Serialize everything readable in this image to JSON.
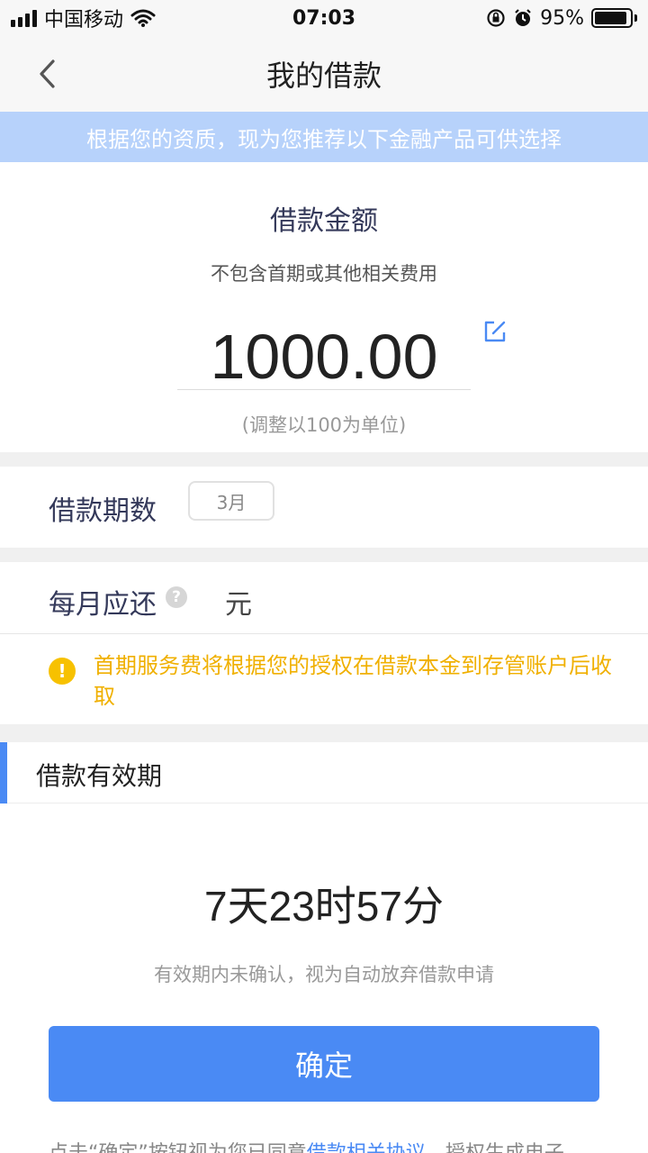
{
  "status_bar": {
    "carrier": "中国移动",
    "time": "07:03",
    "battery": "95%"
  },
  "nav": {
    "title": "我的借款"
  },
  "banner": {
    "text": "根据您的资质，现为您推荐以下金融产品可供选择"
  },
  "amount": {
    "title": "借款金额",
    "subtitle": "不包含首期或其他相关费用",
    "value": "1000.00",
    "hint": "(调整以100为单位)"
  },
  "term": {
    "label": "借款期数",
    "selected": "3月"
  },
  "monthly": {
    "label": "每月应还",
    "unit": "元"
  },
  "notice": {
    "text": "首期服务费将根据您的授权在借款本金到存管账户后收取"
  },
  "validity": {
    "title": "借款有效期",
    "countdown": "7天23时57分",
    "hint": "有效期内未确认，视为自动放弃借款申请"
  },
  "actions": {
    "confirm_label": "确定"
  },
  "footer": {
    "prefix": "点击“确定”按钮视为您已同意",
    "link": "借款相关协议",
    "suffix": "，授权生成电子"
  },
  "colors": {
    "accent": "#4a8af4",
    "banner_bg": "#b7d2fb",
    "warning": "#f0b000"
  },
  "icons": {
    "back": "chevron-left-icon",
    "edit": "edit-icon",
    "help": "help-icon",
    "warning": "warning-icon"
  }
}
